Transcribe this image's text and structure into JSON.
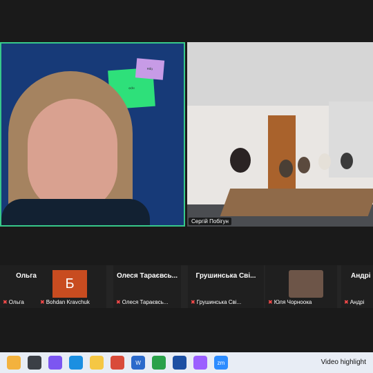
{
  "meeting": {
    "main_tiles": [
      {
        "speaker": ""
      },
      {
        "name_tag": "Сергій Побігун"
      }
    ],
    "gallery": [
      {
        "top_name": "Ольга",
        "label": "Ольга",
        "avatar_letter": ""
      },
      {
        "top_name": "",
        "label": "Bohdan Kravchuk",
        "avatar_letter": "Б"
      },
      {
        "top_name": "Олеся Тараєвсь...",
        "label": "Олеся Тараєвсь..."
      },
      {
        "top_name": "Грушинська Сві...",
        "label": "Грушинська Сві..."
      },
      {
        "top_name": "",
        "label": "Юля Чорноока"
      },
      {
        "top_name": "Андрі",
        "label": "Андрі"
      }
    ]
  },
  "taskbar": {
    "right_text": "Video highlight",
    "icons": [
      "zoom-icon",
      "browser-icon",
      "folder-icon",
      "word-icon",
      "chrome-icon",
      "save-icon",
      "phone-icon",
      "zm"
    ]
  }
}
